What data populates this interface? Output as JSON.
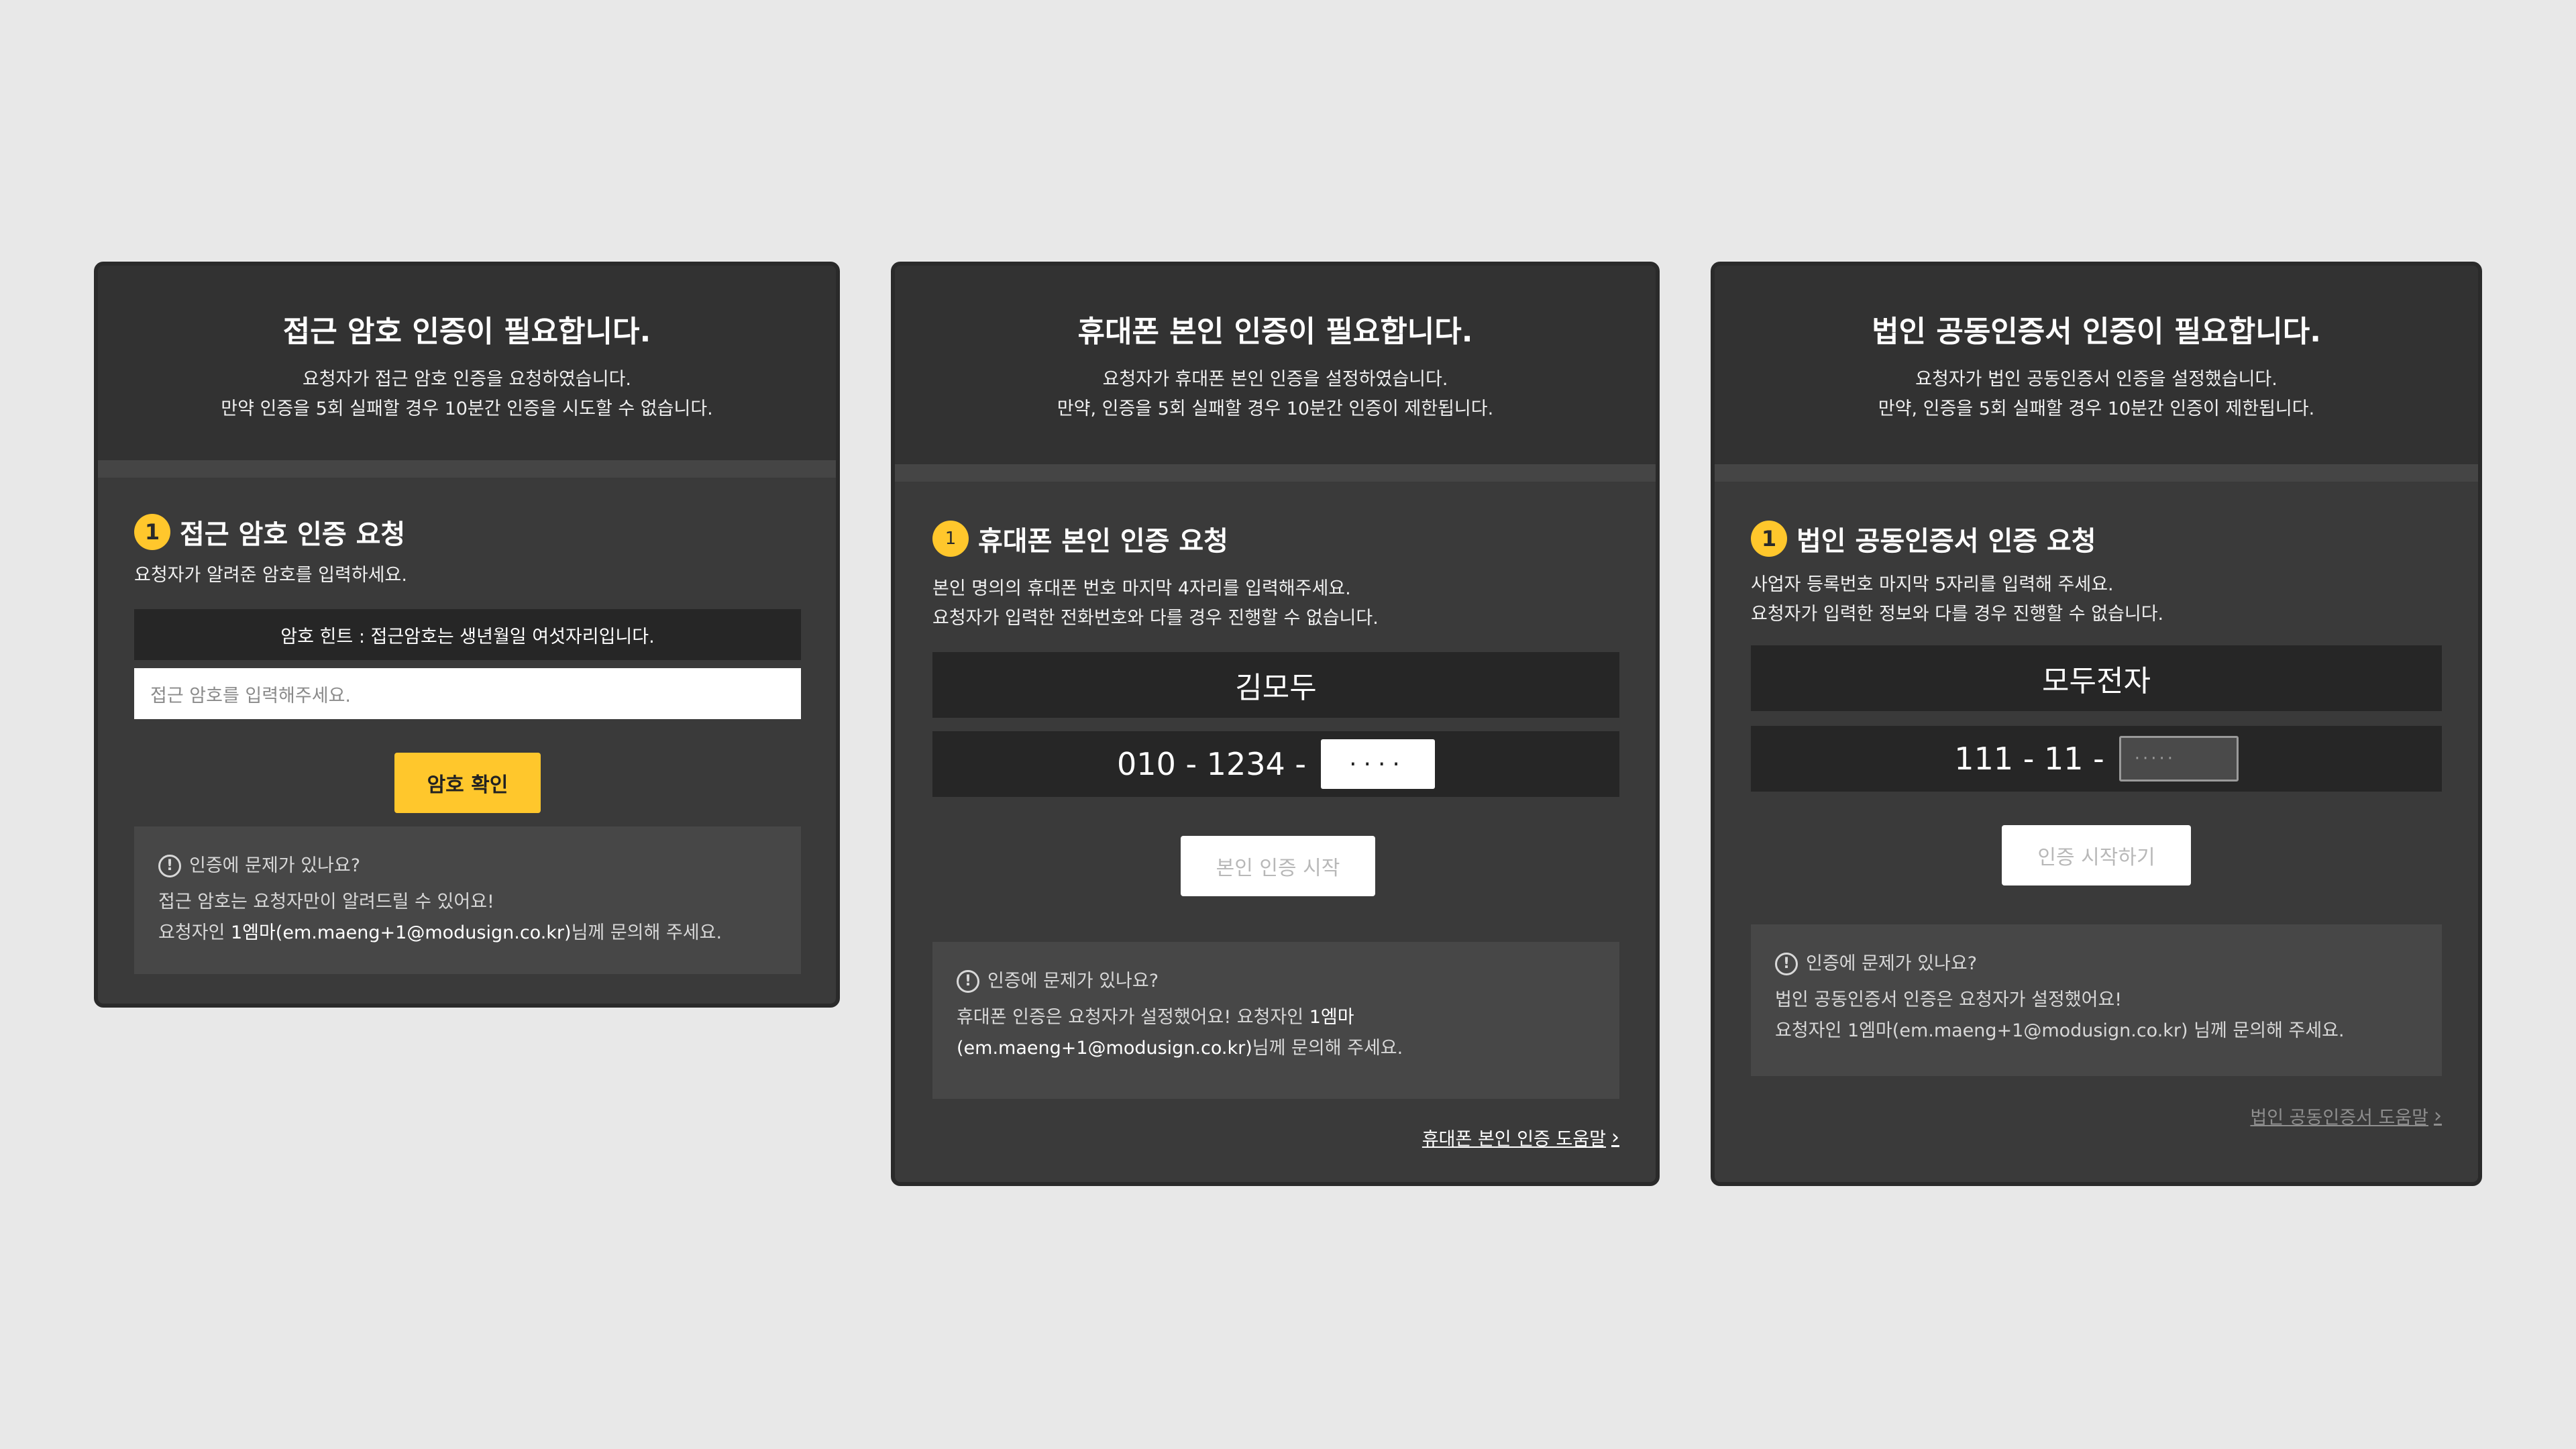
{
  "cards": [
    {
      "title": "접근 암호 인증이 필요합니다.",
      "desc1": "요청자가 접근 암호 인증을 요청하였습니다.",
      "desc2": "만약 인증을 5회 실패할 경우 10분간 인증을 시도할 수 없습니다.",
      "step_num": "1",
      "step_title": "접근 암호 인증 요청",
      "instr1": "요청자가 알려준 암호를 입력하세요.",
      "hint": "암호 힌트 : 접근암호는 생년월일 여섯자리입니다.",
      "input_placeholder": "접근 암호를 입력해주세요.",
      "button": "암호 확인",
      "help_q": "인증에 문제가 있나요?",
      "help_1": "접근 암호는 요청자만이 알려드릴 수 있어요!",
      "help_2a": "요청자인 ",
      "help_2b": "1엠마(em.maeng+1@modusign.co.kr)",
      "help_2c": "님께 문의해 주세요."
    },
    {
      "title": "휴대폰 본인 인증이 필요합니다.",
      "desc1": "요청자가 휴대폰 본인 인증을 설정하였습니다.",
      "desc2": "만약, 인증을 5회 실패할 경우 10분간 인증이 제한됩니다.",
      "step_num": "1",
      "step_title": "휴대폰 본인 인증 요청",
      "instr1": "본인 명의의 휴대폰 번호 마지막 4자리를 입력해주세요.",
      "instr2": "요청자가 입력한 전화번호와 다를 경우 진행할 수 없습니다.",
      "name": "김모두",
      "phone_prefix": "010 - 1234 -",
      "phone_mask": "····",
      "button": "본인 인증 시작",
      "help_q": "인증에 문제가 있나요?",
      "help_1a": "휴대폰 인증은 요청자가 설정했어요! 요청자인 ",
      "help_1b": "1엠마",
      "help_2b": "(em.maeng+1@modusign.co.kr)",
      "help_2c": "님께 문의해 주세요.",
      "link": "휴대폰 본인 인증 도움말",
      "link_chevron": "›"
    },
    {
      "title": "법인 공동인증서 인증이 필요합니다.",
      "desc1": "요청자가 법인 공동인증서 인증을 설정했습니다.",
      "desc2": "만약, 인증을 5회 실패할 경우 10분간 인증이 제한됩니다.",
      "step_num": "1",
      "step_title": "법인 공동인증서 인증 요청",
      "instr1": "사업자 등록번호 마지막 5자리를 입력해 주세요.",
      "instr2": "요청자가 입력한 정보와 다를 경우 진행할 수 없습니다.",
      "name": "모두전자",
      "biz_prefix": "111 - 11 -",
      "biz_mask": "·····",
      "button": "인증 시작하기",
      "help_q": "인증에 문제가 있나요?",
      "help_1": "법인 공동인증서 인증은 요청자가 설정했어요!",
      "help_2": "요청자인 1엠마(em.maeng+1@modusign.co.kr) 님께 문의해 주세요.",
      "link": "법인 공동인증서 도움말",
      "link_chevron": "›"
    }
  ]
}
